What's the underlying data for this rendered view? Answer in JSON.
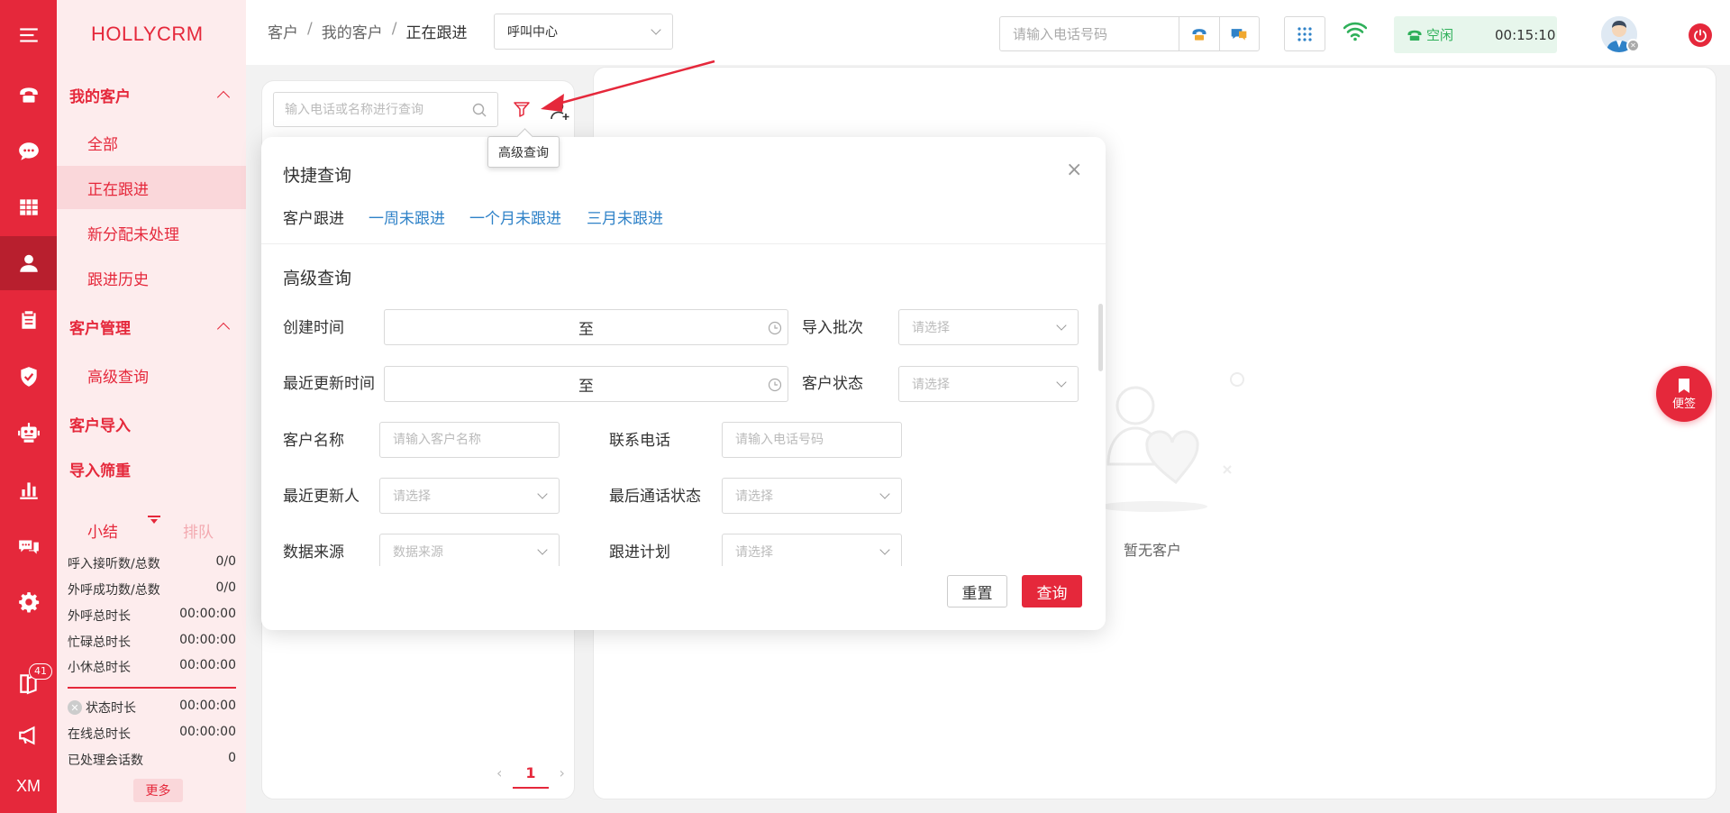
{
  "brand": "HOLLYCRM",
  "rail": {
    "badge_count": "41",
    "footer_text": "XM",
    "icons": [
      "menu-icon",
      "phone-icon",
      "chat-icon",
      "grid-icon",
      "user-icon",
      "clipboard-icon",
      "shield-icon",
      "robot-icon",
      "bar-chart-icon",
      "message-icon",
      "gear-icon",
      "book-icon",
      "megaphone-icon"
    ]
  },
  "sidebar": {
    "group_my_customers": "我的客户",
    "item_all": "全部",
    "item_following": "正在跟进",
    "item_new_unhandled": "新分配未处理",
    "item_history": "跟进历史",
    "group_customer_mgmt": "客户管理",
    "item_advanced_query": "高级查询",
    "group_import": "客户导入",
    "group_import_filter": "导入筛重"
  },
  "summary": {
    "tab_summary": "小结",
    "tab_queue": "排队",
    "rows": [
      {
        "label": "呼入接听数/总数",
        "value": "0/0"
      },
      {
        "label": "外呼成功数/总数",
        "value": "0/0"
      },
      {
        "label": "外呼总时长",
        "value": "00:00:00"
      },
      {
        "label": "忙碌总时长",
        "value": "00:00:00"
      },
      {
        "label": "小休总时长",
        "value": "00:00:00"
      },
      {
        "label": "状态时长",
        "value": "00:00:00"
      },
      {
        "label": "在线总时长",
        "value": "00:00:00"
      },
      {
        "label": "已处理会话数",
        "value": "0"
      }
    ],
    "more_label": "更多"
  },
  "header": {
    "crumb_1": "客户",
    "crumb_2": "我的客户",
    "crumb_3": "正在跟进",
    "crumb_sep": "/",
    "center_select": "呼叫中心",
    "phone_placeholder": "请输入电话号码",
    "status_text": "空闲",
    "timer": "00:15:10"
  },
  "list": {
    "search_placeholder": "输入电话或名称进行查询",
    "tooltip": "高级查询",
    "page_prev": "‹",
    "page_current": "1",
    "page_next": "›"
  },
  "main": {
    "empty_text": "暂无客户",
    "note_button": "便签"
  },
  "query_popup": {
    "title": "快捷查询",
    "close": "×",
    "quick_label": "客户跟进",
    "quick_links": [
      "一周未跟进",
      "一个月未跟进",
      "三月未跟进"
    ],
    "advanced_title": "高级查询",
    "range_sep": "至",
    "fields": {
      "created_time": "创建时间",
      "import_batch": "导入批次",
      "last_updated_time": "最近更新时间",
      "customer_status": "客户状态",
      "customer_name": "客户名称",
      "customer_name_placeholder": "请输入客户名称",
      "contact_phone": "联系电话",
      "contact_phone_placeholder": "请输入电话号码",
      "last_updater": "最近更新人",
      "last_call_status": "最后通话状态",
      "data_source": "数据来源",
      "data_source_placeholder": "数据来源",
      "follow_plan": "跟进计划",
      "select_placeholder": "请选择"
    },
    "reset": "重置",
    "search": "查询"
  },
  "colors": {
    "brand_red": "#e5283b",
    "link_blue": "#2f82c8",
    "status_green": "#2fb05a",
    "sidebar_bg": "#fdeced"
  }
}
